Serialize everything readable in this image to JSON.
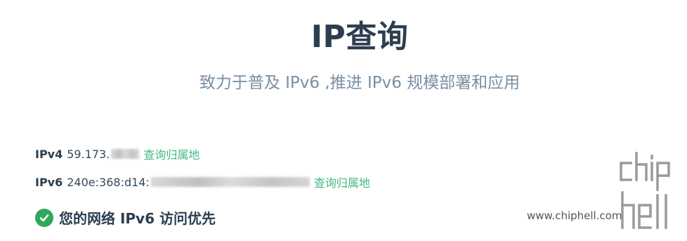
{
  "header": {
    "title": "IP查询",
    "subtitle": "致力于普及 IPv6 ,推进 IPv6 规模部署和应用"
  },
  "ipv4": {
    "label": "IPv4",
    "value": "59.173.",
    "lookup_link": "查询归属地"
  },
  "ipv6": {
    "label": "IPv6",
    "value": "240e:368:d14:",
    "lookup_link": "查询归属地"
  },
  "status": {
    "icon": "check-circle-icon",
    "text": "您的网络 IPv6 访问优先",
    "color": "#2fa85a"
  },
  "watermark": {
    "url": "www.chiphell.com",
    "logo_text": "chip hell"
  },
  "colors": {
    "title": "#2c3e50",
    "subtitle": "#7a8ea3",
    "link": "#42b983"
  }
}
